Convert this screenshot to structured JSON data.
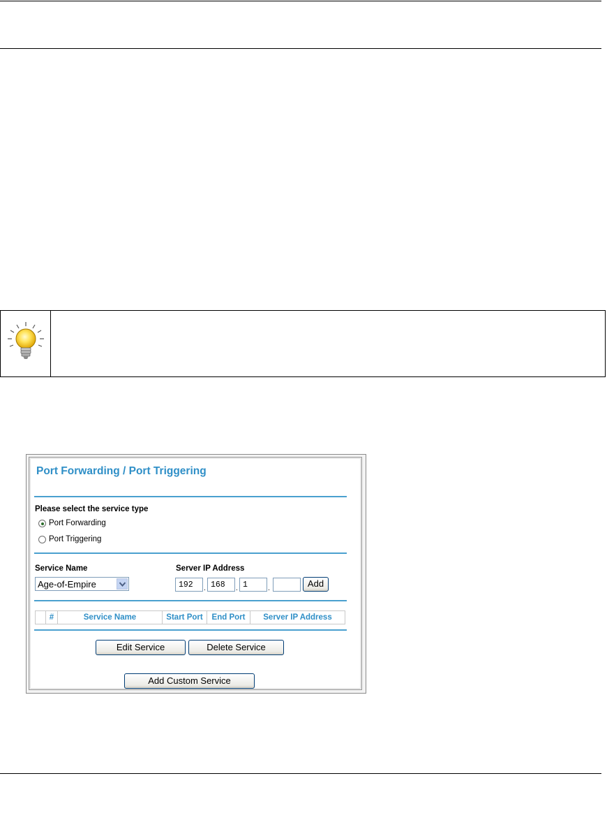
{
  "panel": {
    "title": "Port Forwarding / Port Triggering",
    "service_type_label": "Please select the service type",
    "radio_forwarding": "Port Forwarding",
    "radio_triggering": "Port Triggering",
    "selected_service_type": "Port Forwarding",
    "service_name_label": "Service Name",
    "server_ip_label": "Server IP Address",
    "service_name_value": "Age-of-Empire",
    "ip": [
      "192",
      "168",
      "1",
      ""
    ],
    "add_button": "Add",
    "table_headers": [
      "",
      "#",
      "Service Name",
      "Start Port",
      "End Port",
      "Server IP Address"
    ],
    "edit_button": "Edit Service",
    "delete_button": "Delete Service",
    "add_custom_button": "Add Custom Service"
  },
  "colors": {
    "accent": "#2f8fc7",
    "divider": "#4aa0cf"
  },
  "icons": {
    "tip": "lightbulb-icon"
  }
}
